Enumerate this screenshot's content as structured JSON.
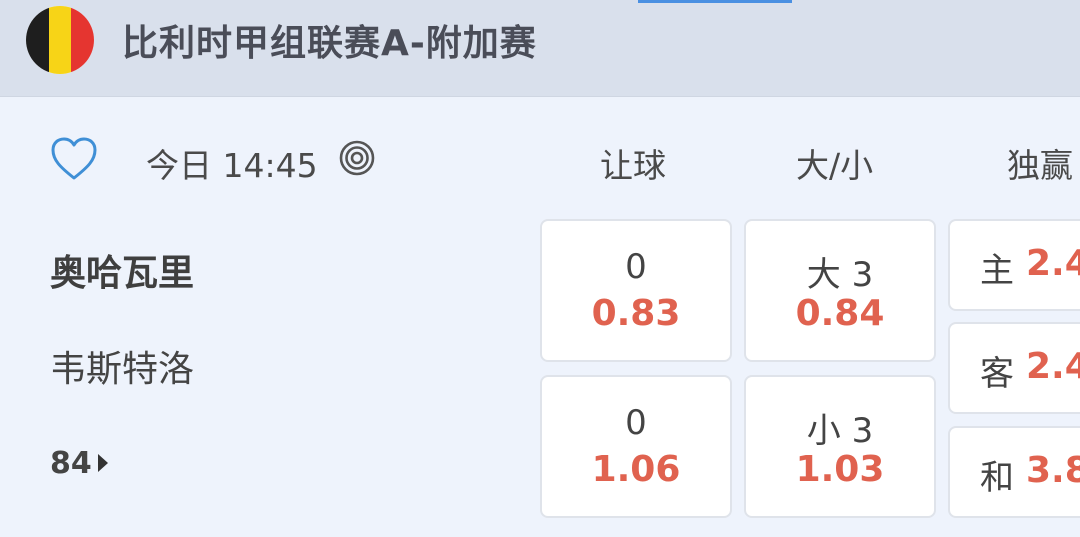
{
  "header": {
    "league_title": "比利时甲组联赛A-附加赛",
    "flag_colors": [
      "#1e1e1e",
      "#f7d417",
      "#e53530"
    ]
  },
  "match": {
    "time": "今日 14:45",
    "home_team": "奥哈瓦里",
    "away_team": "韦斯特洛",
    "more_markets": "84"
  },
  "columns": {
    "handicap": "让球",
    "over_under": "大/小",
    "match_result": "独赢"
  },
  "handicap": [
    {
      "line": "0",
      "odd": "0.83"
    },
    {
      "line": "0",
      "odd": "1.06"
    }
  ],
  "over_under": [
    {
      "line": "大 3",
      "odd": "0.84"
    },
    {
      "line": "小 3",
      "odd": "1.03"
    }
  ],
  "match_result": [
    {
      "label": "主",
      "odd": "2.4"
    },
    {
      "label": "客",
      "odd": "2.4"
    },
    {
      "label": "和",
      "odd": "3.8"
    }
  ],
  "colors": {
    "accent": "#4a90e2",
    "odds": "#e0624f",
    "header_bg": "#d9e0ec",
    "page_bg": "#eef3fc"
  }
}
